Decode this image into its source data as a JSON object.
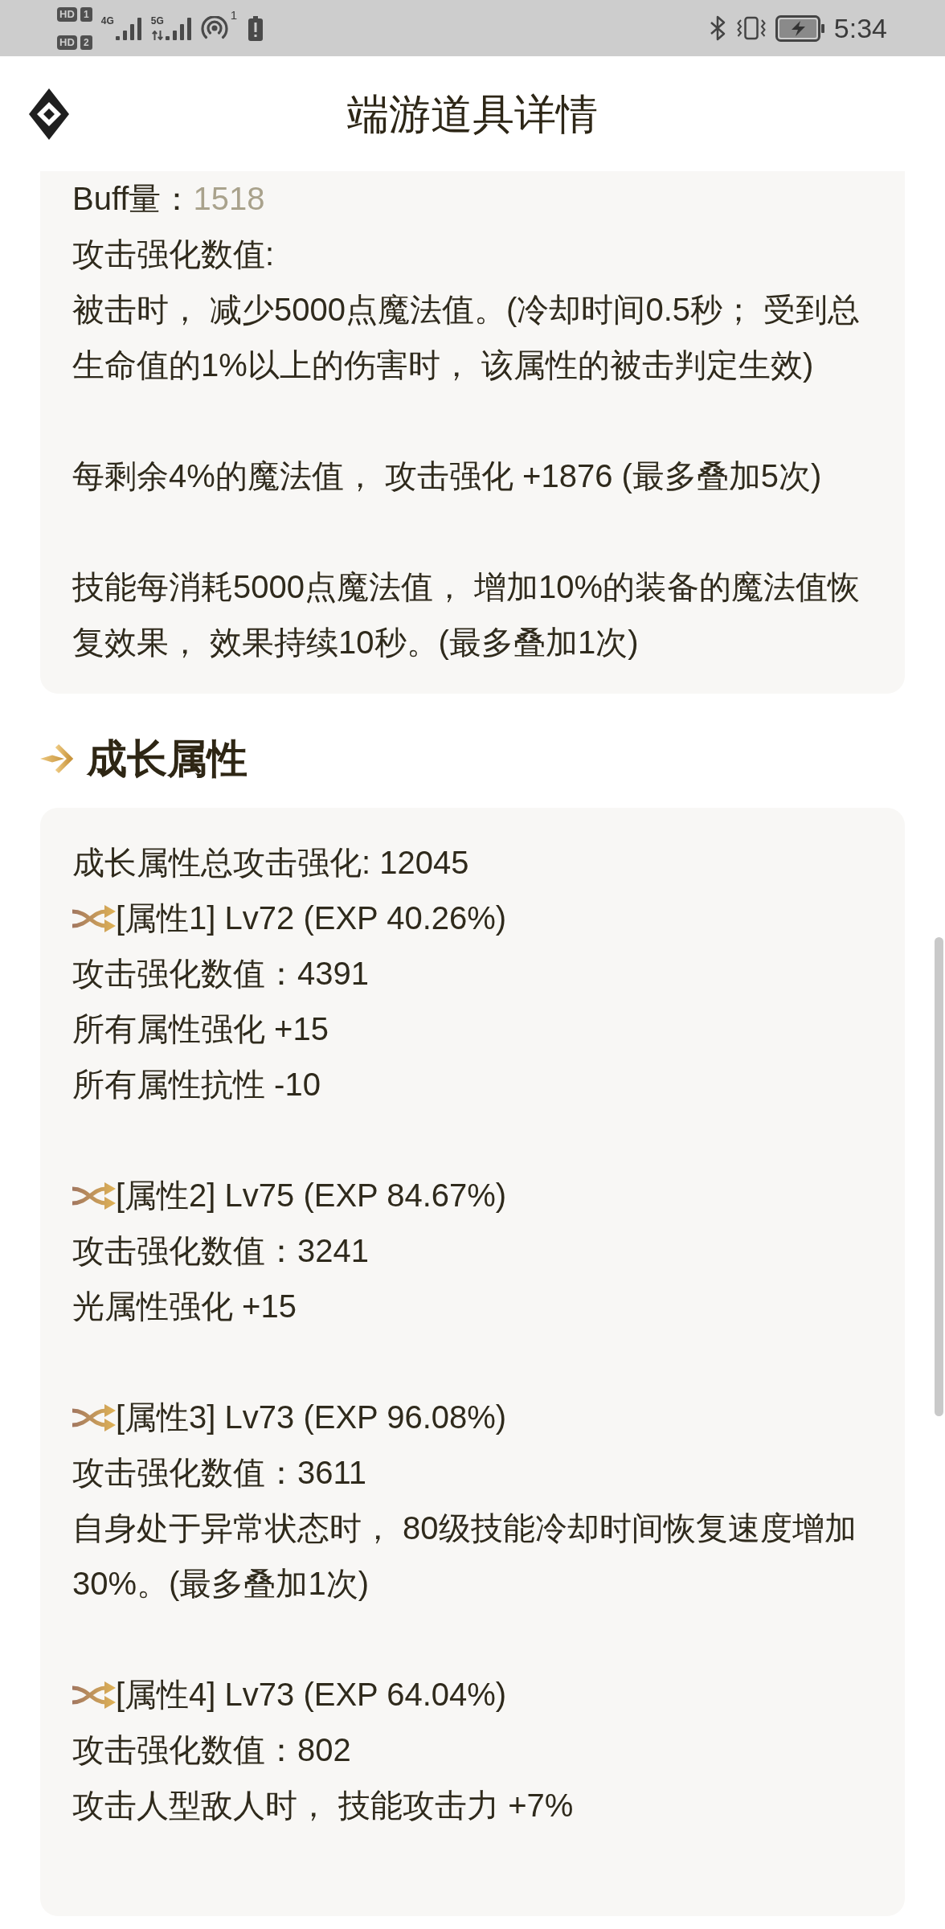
{
  "status_bar": {
    "sims": [
      {
        "label": "HD",
        "slot": "1"
      },
      {
        "label": "HD",
        "slot": "2"
      }
    ],
    "networks": [
      {
        "label": "4G",
        "kind": "plain"
      },
      {
        "label": "5G",
        "kind": "data"
      }
    ],
    "hotspot_count": "1",
    "time": "5:34"
  },
  "header": {
    "title": "端游道具详情"
  },
  "effect_card": {
    "buff_label": "Buff量：",
    "buff_value": "1518",
    "heading": "攻击强化数值:",
    "paragraphs": [
      "被击时， 减少5000点魔法值。(冷却时间0.5秒； 受到总生命值的1%以上的伤害时， 该属性的被击判定生效)",
      "每剩余4%的魔法值， 攻击强化 +1876 (最多叠加5次)",
      "技能每消耗5000点魔法值， 增加10%的装备的魔法值恢复效果， 效果持续10秒。(最多叠加1次)"
    ]
  },
  "growth_section": {
    "title": "成长属性",
    "total": "成长属性总攻击强化: 12045",
    "attributes": [
      {
        "header": "[属性1] Lv72 (EXP 40.26%)",
        "lines": [
          "攻击强化数值：4391",
          "所有属性强化 +15",
          "所有属性抗性 -10"
        ]
      },
      {
        "header": "[属性2] Lv75 (EXP 84.67%)",
        "lines": [
          "攻击强化数值：3241",
          "光属性强化 +15"
        ]
      },
      {
        "header": "[属性3] Lv73 (EXP 96.08%)",
        "lines": [
          "攻击强化数值：3611",
          "自身处于异常状态时， 80级技能冷却时间恢复速度增加30%。(最多叠加1次)"
        ]
      },
      {
        "header": "[属性4] Lv73 (EXP 64.04%)",
        "lines": [
          "攻击强化数值：802",
          "攻击人型敌人时， 技能攻击力 +7%"
        ]
      }
    ]
  }
}
